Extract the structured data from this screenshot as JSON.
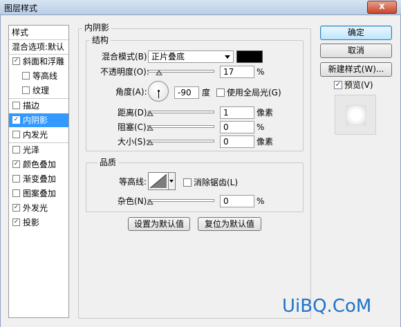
{
  "window": {
    "title": "图层样式",
    "close_glyph": "x"
  },
  "left_list": {
    "header": "样式",
    "blend_options": "混合选项:默认",
    "items": [
      {
        "label": "斜面和浮雕",
        "checked": true,
        "check_glyph": "✓"
      },
      {
        "label": "等高线",
        "checked": false,
        "check_glyph": ""
      },
      {
        "label": "纹理",
        "checked": false,
        "check_glyph": ""
      },
      {
        "label": "描边",
        "checked": false,
        "check_glyph": ""
      },
      {
        "label": "内阴影",
        "checked": true,
        "selected": true,
        "check_glyph": "✓"
      },
      {
        "label": "内发光",
        "checked": false,
        "check_glyph": ""
      },
      {
        "label": "光泽",
        "checked": false,
        "check_glyph": ""
      },
      {
        "label": "颜色叠加",
        "checked": true,
        "check_glyph": "✓"
      },
      {
        "label": "渐变叠加",
        "checked": false,
        "check_glyph": ""
      },
      {
        "label": "图案叠加",
        "checked": false,
        "check_glyph": ""
      },
      {
        "label": "外发光",
        "checked": true,
        "check_glyph": "✓"
      },
      {
        "label": "投影",
        "checked": true,
        "check_glyph": "✓"
      }
    ]
  },
  "inner_shadow": {
    "title": "内阴影",
    "structure": {
      "title": "结构",
      "blend_mode_label": "混合模式(B):",
      "blend_mode_value": "正片叠底",
      "shadow_color": "#000000",
      "opacity_label": "不透明度(O):",
      "opacity_value": "17",
      "opacity_unit": "%",
      "opacity_percent": 17,
      "angle_label": "角度(A):",
      "angle_value": "-90",
      "angle_unit": "度",
      "global_light_label": "使用全局光(G)",
      "global_light_checked": false,
      "distance_label": "距离(D):",
      "distance_value": "1",
      "distance_unit": "像素",
      "choke_label": "阻塞(C):",
      "choke_value": "0",
      "choke_unit": "%",
      "size_label": "大小(S):",
      "size_value": "0",
      "size_unit": "像素"
    },
    "quality": {
      "title": "品质",
      "contour_label": "等高线:",
      "anti_alias_label": "消除锯齿(L)",
      "anti_alias_checked": false,
      "noise_label": "杂色(N):",
      "noise_value": "0",
      "noise_unit": "%"
    },
    "set_default_label": "设置为默认值",
    "reset_default_label": "复位为默认值"
  },
  "buttons": {
    "ok": "确定",
    "cancel": "取消",
    "new_style": "新建样式(W)...",
    "preview_label": "预览(V)",
    "preview_checked": true,
    "preview_check_glyph": "✓"
  },
  "watermark": "UiBQ.CoM"
}
